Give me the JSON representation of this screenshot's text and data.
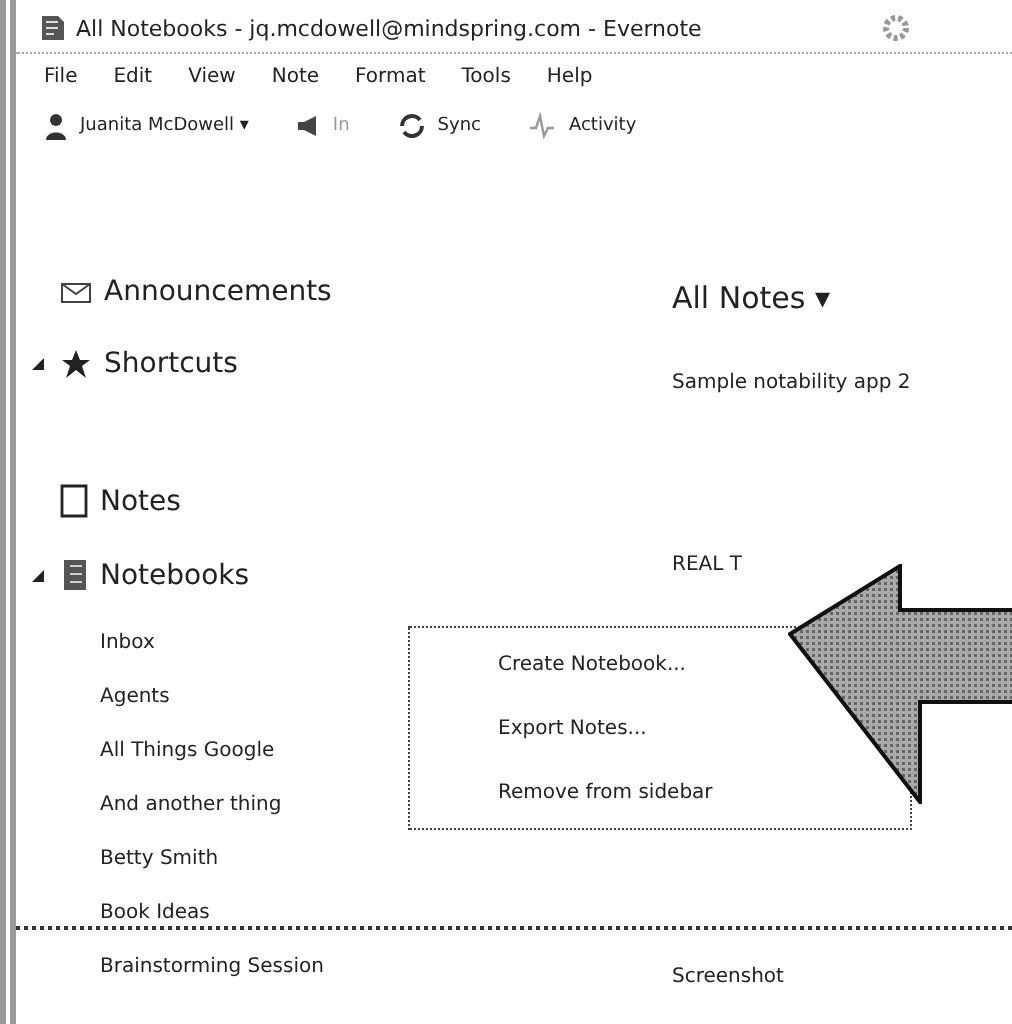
{
  "window": {
    "title": "All Notebooks - jq.mcdowell@mindspring.com - Evernote"
  },
  "menu": [
    "File",
    "Edit",
    "View",
    "Note",
    "Format",
    "Tools",
    "Help"
  ],
  "toolbar": {
    "account": "Juanita McDowell ▾",
    "chat": "In",
    "sync": "Sync",
    "activity": "Activity"
  },
  "sidebar": {
    "sections": [
      {
        "kind": "announcements",
        "label": "Announcements"
      },
      {
        "kind": "shortcuts",
        "label": "Shortcuts",
        "expanded": true
      },
      {
        "kind": "notes",
        "label": "Notes"
      },
      {
        "kind": "notebooks",
        "label": "Notebooks",
        "expanded": true
      }
    ],
    "notebooks": [
      "Inbox",
      "Agents",
      "All Things Google",
      "And another thing",
      "Betty Smith",
      "Book Ideas",
      "Brainstorming Session"
    ]
  },
  "notes_list": {
    "title": "All Notes ▾",
    "notes": [
      "Sample notability app 2",
      "REAL T",
      "Screenshot"
    ]
  },
  "context_menu": [
    "Create Notebook...",
    "Export Notes...",
    "Remove from sidebar"
  ]
}
